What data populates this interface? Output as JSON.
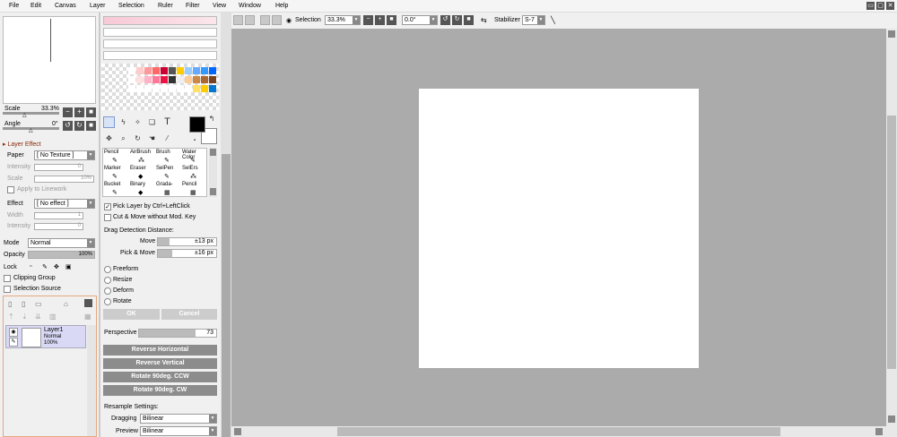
{
  "menus": [
    "File",
    "Edit",
    "Canvas",
    "Layer",
    "Selection",
    "Ruler",
    "Filter",
    "View",
    "Window",
    "Help"
  ],
  "window_controls": [
    "▭",
    "▢",
    "✕"
  ],
  "toolbar": {
    "selection_label": "Selection",
    "zoom": "33.3%",
    "angle": "0.0°",
    "stabilizer_label": "Stabilizer",
    "stabilizer": "S-7",
    "minus": "−",
    "plus": "+",
    "dot": "■",
    "rot_ccw": "↺",
    "rot_cw": "↻",
    "swap": "⇆",
    "slash": "╲"
  },
  "navigator": {
    "scale_label": "Scale",
    "scale_value": "33.3%",
    "angle_label": "Angle",
    "angle_value": "0°",
    "minus": "−",
    "plus": "+",
    "dot": "■",
    "rot_ccw": "↺",
    "rot_cw": "↻"
  },
  "layer_effect": {
    "title": "Layer Effect",
    "paper_label": "Paper",
    "paper_value": "[ No Texture ]",
    "intensity_label": "Intensity",
    "intensity_value": "0",
    "scale_label": "Scale",
    "scale_value": "10%",
    "apply_linework": "Apply to Linework",
    "effect_label": "Effect",
    "effect_value": "[ No effect ]",
    "width_label": "Width",
    "width_value": "1",
    "intensity2_label": "Intensity",
    "intensity2_value": "0"
  },
  "layer_props": {
    "mode_label": "Mode",
    "mode_value": "Normal",
    "opacity_label": "Opacity",
    "opacity_value": "100%",
    "opacity_fraction": 1.0,
    "lock_label": "Lock",
    "clipping_group": "Clipping Group",
    "selection_source": "Selection Source"
  },
  "layers": [
    {
      "name": "Layer1",
      "mode": "Normal",
      "opacity": "100%"
    }
  ],
  "palette": {
    "colors": [
      "#fbe3ea",
      "#f9cdd8",
      "#f7b6c6",
      "#f39fb4",
      "#ef88a3",
      "#000000",
      "#ffffff",
      "#ffffff",
      "#ffffff",
      "#ffffff",
      "#ffffff"
    ]
  },
  "swatches": {
    "row1": [
      "#ffffff",
      "#ffcccc",
      "#ff9999",
      "#ff6666",
      "#cc0033",
      "#555555",
      "#ffcc00",
      "#99ccff",
      "#66aaff",
      "#3399ff",
      "#0066ff"
    ],
    "row2": [
      "#ffffff",
      "#ffe0e0",
      "#ffb3c6",
      "#ff7799",
      "#ee1144",
      "#333333",
      "#eeeeee",
      "#ffcc99",
      "#cc8844",
      "#aa6633",
      "#774422"
    ],
    "row3": [
      "#ffffff",
      "#ffffff",
      "#ffffff",
      "#ffffff",
      "#ffffff",
      "#ffffff",
      "#ffffff",
      "#ffffff",
      "#ffe066",
      "#ffcc00",
      "#0077cc"
    ]
  },
  "tools": {
    "text_tool": "T",
    "primary_color": "#000000",
    "secondary_color": "#ffffff"
  },
  "brushes": [
    {
      "name": "Pencil",
      "glyph": "✎"
    },
    {
      "name": "AirBrush",
      "glyph": "⁂"
    },
    {
      "name": "Brush",
      "glyph": "✎"
    },
    {
      "name": "Water Color",
      "glyph": "✎"
    },
    {
      "name": "Marker",
      "glyph": "✎"
    },
    {
      "name": "Eraser",
      "glyph": "◆"
    },
    {
      "name": "SelPen",
      "glyph": "✎"
    },
    {
      "name": "SelErs",
      "glyph": "⁂"
    },
    {
      "name": "Bucket",
      "glyph": "✎"
    },
    {
      "name": "Binary",
      "glyph": "◆"
    },
    {
      "name": "Grada-",
      "glyph": "▦"
    },
    {
      "name": "Pencil",
      "glyph": "▦"
    }
  ],
  "move_tool": {
    "pick_layer": "Pick Layer by Ctrl+LeftClick",
    "cut_move": "Cut & Move without Mod. Key",
    "drag_title": "Drag Detection Distance:",
    "move_label": "Move",
    "move_value": "±13 px",
    "move_fraction": 0.2,
    "pickmove_label": "Pick & Move",
    "pickmove_value": "±16 px",
    "pickmove_fraction": 0.24
  },
  "transform": {
    "options": [
      "Freeform",
      "Resize",
      "Deform",
      "Rotate"
    ],
    "ok": "OK",
    "cancel": "Cancel",
    "perspective_label": "Perspective",
    "perspective_value": "73",
    "perspective_fraction": 0.73,
    "buttons": [
      "Reverse Horizontal",
      "Reverse Vertical",
      "Rotate 90deg. CCW",
      "Rotate 90deg. CW"
    ],
    "resample_title": "Resample Settings:",
    "dragging_label": "Dragging",
    "dragging_value": "Bilinear",
    "preview_label": "Preview",
    "preview_value": "Bilinear"
  }
}
